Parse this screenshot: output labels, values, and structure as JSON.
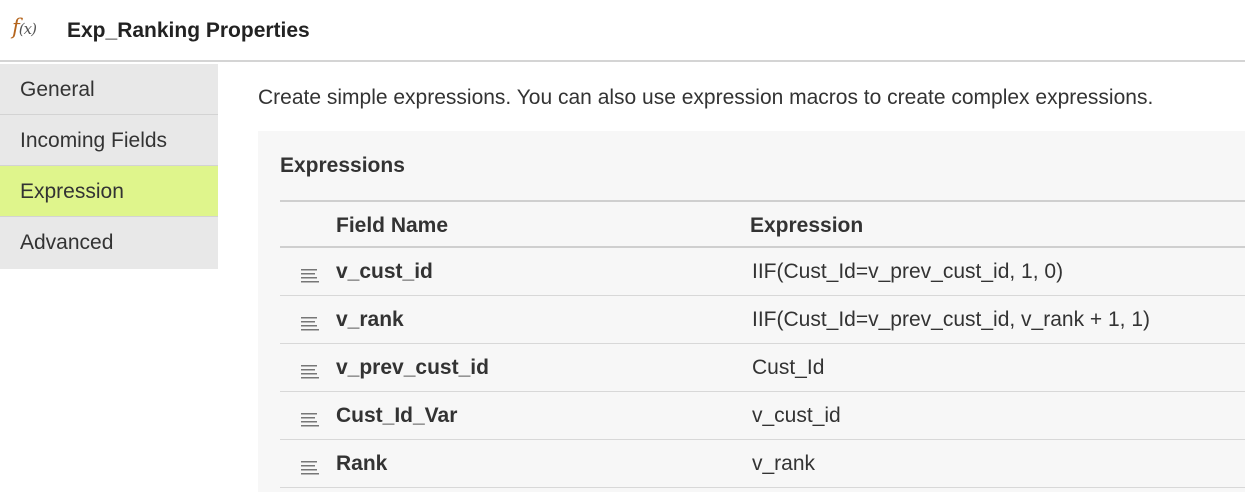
{
  "header": {
    "icon": "function-fx-icon",
    "icon_f": "f",
    "icon_x": "(x)",
    "title": "Exp_Ranking Properties"
  },
  "sidebar": {
    "items": [
      {
        "label": "General",
        "active": false
      },
      {
        "label": "Incoming Fields",
        "active": false
      },
      {
        "label": "Expression",
        "active": true
      },
      {
        "label": "Advanced",
        "active": false
      }
    ],
    "active_color": "#dff58c"
  },
  "main": {
    "description": "Create simple expressions. You can also use expression macros to create complex expressions.",
    "panel_title": "Expressions",
    "columns": {
      "name": "Field Name",
      "expression": "Expression"
    },
    "rows": [
      {
        "name": "v_cust_id",
        "expression": "IIF(Cust_Id=v_prev_cust_id, 1, 0)"
      },
      {
        "name": "v_rank",
        "expression": "IIF(Cust_Id=v_prev_cust_id, v_rank + 1, 1)"
      },
      {
        "name": "v_prev_cust_id",
        "expression": "Cust_Id"
      },
      {
        "name": "Cust_Id_Var",
        "expression": "v_cust_id"
      },
      {
        "name": "Rank",
        "expression": "v_rank"
      }
    ]
  }
}
